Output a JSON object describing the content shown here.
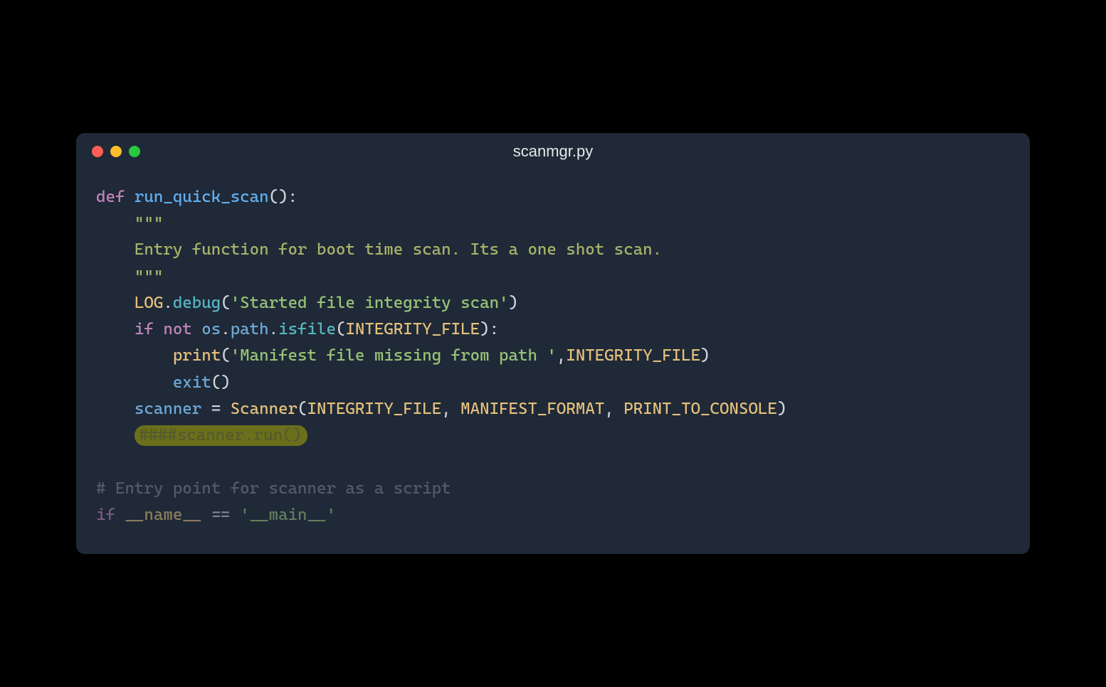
{
  "window": {
    "title": "scanmgr.py"
  },
  "code": {
    "line1": {
      "def": "def",
      "name": "run_quick_scan",
      "parens": "():"
    },
    "line2": "\"\"\"",
    "line3": "Entry function for boot time scan. Its a one shot scan.",
    "line4": "\"\"\"",
    "line5": {
      "log": "LOG",
      "dot": ".",
      "debug": "debug",
      "open": "(",
      "str": "'Started file integrity scan'",
      "close": ")"
    },
    "line6": {
      "if": "if",
      "not": "not",
      "os": "os",
      "dot1": ".",
      "path": "path",
      "dot2": ".",
      "isfile": "isfile",
      "open": "(",
      "arg": "INTEGRITY_FILE",
      "close": "):"
    },
    "line7": {
      "print": "print",
      "open": "(",
      "str": "'Manifest file missing from path '",
      "comma": ",",
      "arg": "INTEGRITY_FILE",
      "close": ")"
    },
    "line8": {
      "exit": "exit",
      "parens": "()"
    },
    "line9": {
      "scanner": "scanner",
      "eq": " = ",
      "cls": "Scanner",
      "open": "(",
      "a1": "INTEGRITY_FILE",
      "c1": ", ",
      "a2": "MANIFEST_FORMAT",
      "c2": ", ",
      "a3": "PRINT_TO_CONSOLE",
      "close": ")"
    },
    "line10": "####scanner.run()",
    "line12": "# Entry point for scanner as a script",
    "line13": {
      "if": "if",
      "name": "__name__",
      "eq": " == ",
      "main": "'__main__'"
    }
  }
}
